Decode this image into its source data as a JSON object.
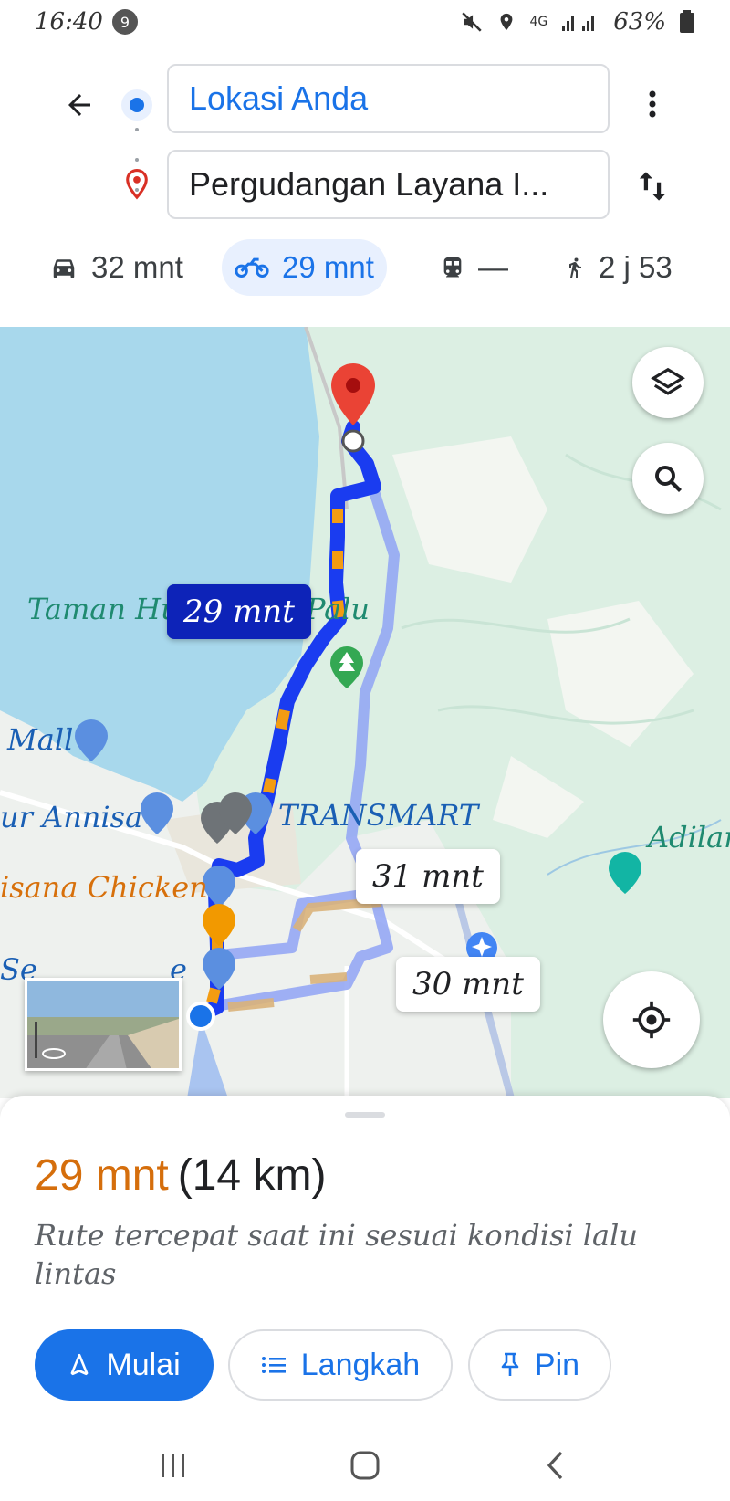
{
  "status_bar": {
    "time": "16:40",
    "notification_count": "9",
    "network": "4G",
    "battery": "63%"
  },
  "directions": {
    "origin": "Lokasi Anda",
    "destination": "Pergudangan Layana I..."
  },
  "modes": [
    {
      "icon": "car-icon",
      "label": "32 mnt"
    },
    {
      "icon": "motorcycle-icon",
      "label": "29 mnt",
      "active": true
    },
    {
      "icon": "transit-icon",
      "label": "—"
    },
    {
      "icon": "walk-icon",
      "label": "2 j 53"
    }
  ],
  "map": {
    "labels": {
      "taman": "Taman Hu",
      "palu": "Palu",
      "mall": "Mall",
      "annisa": "ur Annisa",
      "transmart": "TRANSMART",
      "chicken": "isana Chicken",
      "adila": "Adilar",
      "se": "Se",
      "e": "e"
    },
    "route_chips": {
      "main": "29 mnt",
      "alt1": "31 mnt",
      "alt2": "30 mnt"
    }
  },
  "summary": {
    "time": "29 mnt",
    "distance": "(14 km)",
    "description": "Rute tercepat saat ini sesuai kondisi lalu lintas"
  },
  "actions": {
    "start": "Mulai",
    "steps": "Langkah",
    "pin": "Pin"
  },
  "colors": {
    "accent": "#1a73e8",
    "route": "#1a3cf0",
    "traffic": "#f39c12",
    "water": "#a8d8ec",
    "land": "#dcefe3"
  }
}
